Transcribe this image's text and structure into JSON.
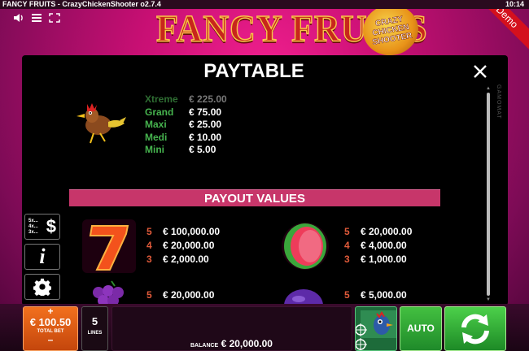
{
  "topbar": {
    "title": "FANCY FRUITS - CrazyChickenShooter o2.7.4",
    "time": "10:14"
  },
  "logo": {
    "main": "FANCY FRUITS",
    "badge": [
      "CRAZY",
      "CHICKEN",
      "SHOOTER"
    ]
  },
  "demo_label": "Demo",
  "paytable": {
    "title": "PAYTABLE",
    "provider": "GAMOMAT",
    "jackpots": [
      {
        "name": "Xtreme",
        "value": "€ 225.00"
      },
      {
        "name": "Grand",
        "value": "€ 75.00"
      },
      {
        "name": "Maxi",
        "value": "€ 25.00"
      },
      {
        "name": "Medi",
        "value": "€ 10.00"
      },
      {
        "name": "Mini",
        "value": "€ 5.00"
      }
    ],
    "payout_header": "PAYOUT VALUES",
    "symbols": [
      {
        "symbol": "seven",
        "pays": [
          {
            "count": "5",
            "amount": "€ 100,000.00"
          },
          {
            "count": "4",
            "amount": "€ 20,000.00"
          },
          {
            "count": "3",
            "amount": "€ 2,000.00"
          }
        ]
      },
      {
        "symbol": "watermelon",
        "pays": [
          {
            "count": "5",
            "amount": "€ 20,000.00"
          },
          {
            "count": "4",
            "amount": "€ 4,000.00"
          },
          {
            "count": "3",
            "amount": "€ 1,000.00"
          }
        ]
      },
      {
        "symbol": "grapes",
        "pays": [
          {
            "count": "5",
            "amount": "€ 20,000.00"
          }
        ]
      },
      {
        "symbol": "plum",
        "pays": [
          {
            "count": "5",
            "amount": "€ 5,000.00"
          }
        ]
      }
    ]
  },
  "side": {
    "dollar_small": [
      "5x...",
      "4x...",
      "3x..."
    ],
    "dollar_big": "$",
    "info": "i"
  },
  "bottom": {
    "bet_plus": "+",
    "bet_minus": "–",
    "bet_amount": "€ 100.50",
    "bet_label": "TOTAL BET",
    "lines_value": "5",
    "lines_label": "LINES",
    "balance_label": "BALANCE",
    "balance_value": "€ 20,000.00",
    "auto_label": "AUTO"
  }
}
